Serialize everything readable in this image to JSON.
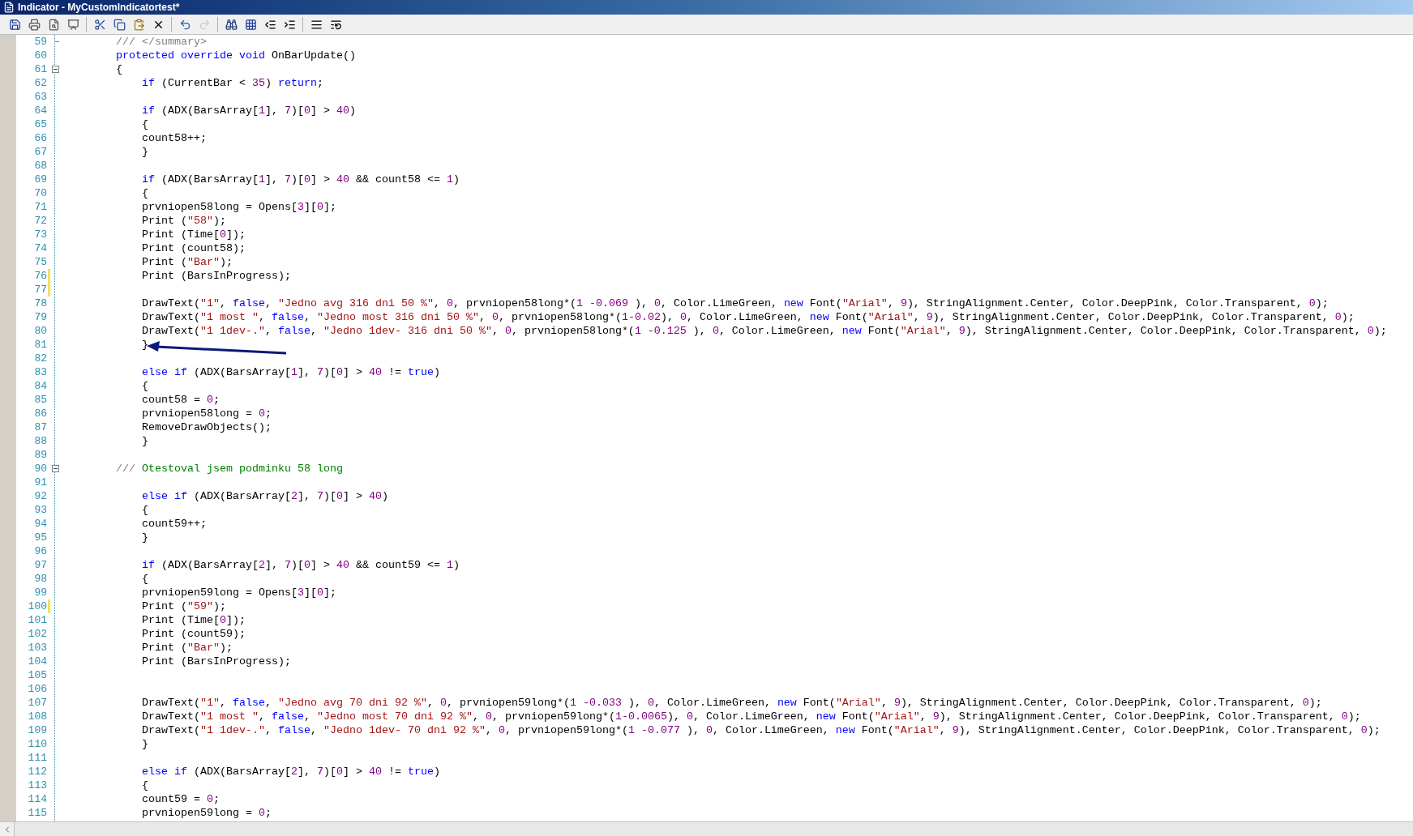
{
  "window": {
    "title": "Indicator - MyCustomIndicatortest*"
  },
  "toolbar": {
    "buttons": [
      {
        "disabled": false
      },
      {
        "disabled": false
      },
      {
        "disabled": false
      },
      {
        "disabled": false
      },
      {
        "disabled": false
      },
      {
        "disabled": false
      },
      {
        "disabled": false
      },
      {
        "disabled": false
      },
      {
        "disabled": false
      },
      {
        "disabled": true
      },
      {
        "disabled": false
      },
      {
        "disabled": false
      },
      {
        "disabled": false
      },
      {
        "disabled": false
      },
      {
        "disabled": false
      },
      {
        "disabled": false
      }
    ]
  },
  "editor": {
    "lines": [
      {
        "number": "59",
        "changed": false,
        "kind": "foldend",
        "tokens": [
          {
            "text": "        /// </summary>",
            "kind": "doc"
          }
        ]
      },
      {
        "number": "60",
        "changed": false,
        "kind": "code",
        "tokens": [
          {
            "text": "        protected override void",
            "kind": "keyword"
          },
          {
            "text": " OnBarUpdate()",
            "kind": "plain"
          }
        ]
      },
      {
        "number": "61",
        "changed": false,
        "kind": "foldstart",
        "tokens": [
          {
            "text": "        {",
            "kind": "plain"
          }
        ]
      },
      {
        "number": "62",
        "changed": false,
        "kind": "code",
        "tokens": [
          {
            "text": "            if",
            "kind": "keyword"
          },
          {
            "text": " (CurrentBar < ",
            "kind": "plain"
          },
          {
            "text": "35",
            "kind": "number"
          },
          {
            "text": ") ",
            "kind": "plain"
          },
          {
            "text": "return",
            "kind": "keyword"
          },
          {
            "text": ";",
            "kind": "plain"
          }
        ]
      },
      {
        "number": "63",
        "changed": false,
        "kind": "code"
      },
      {
        "number": "64",
        "changed": false,
        "kind": "code",
        "tokens": [
          {
            "text": "            if",
            "kind": "keyword"
          },
          {
            "text": " (ADX(BarsArray[",
            "kind": "plain"
          },
          {
            "text": "1",
            "kind": "number"
          },
          {
            "text": "], ",
            "kind": "plain"
          },
          {
            "text": "7",
            "kind": "number"
          },
          {
            "text": ")[",
            "kind": "plain"
          },
          {
            "text": "0",
            "kind": "number"
          },
          {
            "text": "] > ",
            "kind": "plain"
          },
          {
            "text": "40",
            "kind": "number"
          },
          {
            "text": ")",
            "kind": "plain"
          }
        ]
      },
      {
        "number": "65",
        "changed": false,
        "kind": "code",
        "tokens": [
          {
            "text": "            {",
            "kind": "plain"
          }
        ]
      },
      {
        "number": "66",
        "changed": false,
        "kind": "code",
        "tokens": [
          {
            "text": "            count58++;",
            "kind": "plain"
          }
        ]
      },
      {
        "number": "67",
        "changed": false,
        "kind": "code",
        "tokens": [
          {
            "text": "            }",
            "kind": "plain"
          }
        ]
      },
      {
        "number": "68",
        "changed": false,
        "kind": "code"
      },
      {
        "number": "69",
        "changed": false,
        "kind": "code",
        "tokens": [
          {
            "text": "            if",
            "kind": "keyword"
          },
          {
            "text": " (ADX(BarsArray[",
            "kind": "plain"
          },
          {
            "text": "1",
            "kind": "number"
          },
          {
            "text": "], ",
            "kind": "plain"
          },
          {
            "text": "7",
            "kind": "number"
          },
          {
            "text": ")[",
            "kind": "plain"
          },
          {
            "text": "0",
            "kind": "number"
          },
          {
            "text": "] > ",
            "kind": "plain"
          },
          {
            "text": "40",
            "kind": "number"
          },
          {
            "text": " && count58 <= ",
            "kind": "plain"
          },
          {
            "text": "1",
            "kind": "number"
          },
          {
            "text": ")",
            "kind": "plain"
          }
        ]
      },
      {
        "number": "70",
        "changed": false,
        "kind": "code",
        "tokens": [
          {
            "text": "            {",
            "kind": "plain"
          }
        ]
      },
      {
        "number": "71",
        "changed": false,
        "kind": "code",
        "tokens": [
          {
            "text": "            prvniopen58long = Opens[",
            "kind": "plain"
          },
          {
            "text": "3",
            "kind": "number"
          },
          {
            "text": "][",
            "kind": "plain"
          },
          {
            "text": "0",
            "kind": "number"
          },
          {
            "text": "];",
            "kind": "plain"
          }
        ]
      },
      {
        "number": "72",
        "changed": false,
        "kind": "code",
        "tokens": [
          {
            "text": "            Print (",
            "kind": "plain"
          },
          {
            "text": "\"58\"",
            "kind": "string"
          },
          {
            "text": ");",
            "kind": "plain"
          }
        ]
      },
      {
        "number": "73",
        "changed": false,
        "kind": "code",
        "tokens": [
          {
            "text": "            Print (Time[",
            "kind": "plain"
          },
          {
            "text": "0",
            "kind": "number"
          },
          {
            "text": "]);",
            "kind": "plain"
          }
        ]
      },
      {
        "number": "74",
        "changed": false,
        "kind": "code",
        "tokens": [
          {
            "text": "            Print (count58);",
            "kind": "plain"
          }
        ]
      },
      {
        "number": "75",
        "changed": false,
        "kind": "code",
        "tokens": [
          {
            "text": "            Print (",
            "kind": "plain"
          },
          {
            "text": "\"Bar\"",
            "kind": "string"
          },
          {
            "text": ");",
            "kind": "plain"
          }
        ]
      },
      {
        "number": "76",
        "changed": true,
        "kind": "code",
        "tokens": [
          {
            "text": "            Print (BarsInProgress);",
            "kind": "plain"
          }
        ]
      },
      {
        "number": "77",
        "changed": true,
        "kind": "code"
      },
      {
        "number": "78",
        "changed": false,
        "kind": "code",
        "tokens": [
          {
            "text": "            DrawText(",
            "kind": "plain"
          },
          {
            "text": "\"1\"",
            "kind": "string"
          },
          {
            "text": ", ",
            "kind": "plain"
          },
          {
            "text": "false",
            "kind": "keyword"
          },
          {
            "text": ", ",
            "kind": "plain"
          },
          {
            "text": "\"Jedno avg 316 dni 50 %\"",
            "kind": "string"
          },
          {
            "text": ", ",
            "kind": "plain"
          },
          {
            "text": "0",
            "kind": "number"
          },
          {
            "text": ", prvniopen58long*(",
            "kind": "plain"
          },
          {
            "text": "1 -0.069",
            "kind": "number"
          },
          {
            "text": " ), ",
            "kind": "plain"
          },
          {
            "text": "0",
            "kind": "number"
          },
          {
            "text": ", Color.LimeGreen, ",
            "kind": "plain"
          },
          {
            "text": "new",
            "kind": "keyword"
          },
          {
            "text": " Font(",
            "kind": "plain"
          },
          {
            "text": "\"Arial\"",
            "kind": "string"
          },
          {
            "text": ", ",
            "kind": "plain"
          },
          {
            "text": "9",
            "kind": "number"
          },
          {
            "text": "), StringAlignment.Center, Color.DeepPink, Color.Transparent, ",
            "kind": "plain"
          },
          {
            "text": "0",
            "kind": "number"
          },
          {
            "text": ");",
            "kind": "plain"
          }
        ]
      },
      {
        "number": "79",
        "changed": false,
        "kind": "code",
        "tokens": [
          {
            "text": "            DrawText(",
            "kind": "plain"
          },
          {
            "text": "\"1 most \"",
            "kind": "string"
          },
          {
            "text": ", ",
            "kind": "plain"
          },
          {
            "text": "false",
            "kind": "keyword"
          },
          {
            "text": ", ",
            "kind": "plain"
          },
          {
            "text": "\"Jedno most 316 dni 50 %\"",
            "kind": "string"
          },
          {
            "text": ", ",
            "kind": "plain"
          },
          {
            "text": "0",
            "kind": "number"
          },
          {
            "text": ", prvniopen58long*(",
            "kind": "plain"
          },
          {
            "text": "1-0.02",
            "kind": "number"
          },
          {
            "text": "), ",
            "kind": "plain"
          },
          {
            "text": "0",
            "kind": "number"
          },
          {
            "text": ", Color.LimeGreen, ",
            "kind": "plain"
          },
          {
            "text": "new",
            "kind": "keyword"
          },
          {
            "text": " Font(",
            "kind": "plain"
          },
          {
            "text": "\"Arial\"",
            "kind": "string"
          },
          {
            "text": ", ",
            "kind": "plain"
          },
          {
            "text": "9",
            "kind": "number"
          },
          {
            "text": "), StringAlignment.Center, Color.DeepPink, Color.Transparent, ",
            "kind": "plain"
          },
          {
            "text": "0",
            "kind": "number"
          },
          {
            "text": ");",
            "kind": "plain"
          }
        ]
      },
      {
        "number": "80",
        "changed": false,
        "kind": "code",
        "tokens": [
          {
            "text": "            DrawText(",
            "kind": "plain"
          },
          {
            "text": "\"1 1dev-.\"",
            "kind": "string"
          },
          {
            "text": ", ",
            "kind": "plain"
          },
          {
            "text": "false",
            "kind": "keyword"
          },
          {
            "text": ", ",
            "kind": "plain"
          },
          {
            "text": "\"Jedno 1dev- 316 dni 50 %\"",
            "kind": "string"
          },
          {
            "text": ", ",
            "kind": "plain"
          },
          {
            "text": "0",
            "kind": "number"
          },
          {
            "text": ", prvniopen58long*(",
            "kind": "plain"
          },
          {
            "text": "1 -0.125",
            "kind": "number"
          },
          {
            "text": " ), ",
            "kind": "plain"
          },
          {
            "text": "0",
            "kind": "number"
          },
          {
            "text": ", Color.LimeGreen, ",
            "kind": "plain"
          },
          {
            "text": "new",
            "kind": "keyword"
          },
          {
            "text": " Font(",
            "kind": "plain"
          },
          {
            "text": "\"Arial\"",
            "kind": "string"
          },
          {
            "text": ", ",
            "kind": "plain"
          },
          {
            "text": "9",
            "kind": "number"
          },
          {
            "text": "), StringAlignment.Center, Color.DeepPink, Color.Transparent, ",
            "kind": "plain"
          },
          {
            "text": "0",
            "kind": "number"
          },
          {
            "text": ");",
            "kind": "plain"
          }
        ]
      },
      {
        "number": "81",
        "changed": false,
        "kind": "code",
        "tokens": [
          {
            "text": "            }",
            "kind": "plain"
          }
        ]
      },
      {
        "number": "82",
        "changed": false,
        "kind": "code"
      },
      {
        "number": "83",
        "changed": false,
        "kind": "code",
        "tokens": [
          {
            "text": "            else if",
            "kind": "keyword"
          },
          {
            "text": " (ADX(BarsArray[",
            "kind": "plain"
          },
          {
            "text": "1",
            "kind": "number"
          },
          {
            "text": "], ",
            "kind": "plain"
          },
          {
            "text": "7",
            "kind": "number"
          },
          {
            "text": ")[",
            "kind": "plain"
          },
          {
            "text": "0",
            "kind": "number"
          },
          {
            "text": "] > ",
            "kind": "plain"
          },
          {
            "text": "40",
            "kind": "number"
          },
          {
            "text": " != ",
            "kind": "plain"
          },
          {
            "text": "true",
            "kind": "keyword"
          },
          {
            "text": ")",
            "kind": "plain"
          }
        ]
      },
      {
        "number": "84",
        "changed": false,
        "kind": "code",
        "tokens": [
          {
            "text": "            {",
            "kind": "plain"
          }
        ]
      },
      {
        "number": "85",
        "changed": false,
        "kind": "code",
        "tokens": [
          {
            "text": "            count58 = ",
            "kind": "plain"
          },
          {
            "text": "0",
            "kind": "number"
          },
          {
            "text": ";",
            "kind": "plain"
          }
        ]
      },
      {
        "number": "86",
        "changed": false,
        "kind": "code",
        "tokens": [
          {
            "text": "            prvniopen58long = ",
            "kind": "plain"
          },
          {
            "text": "0",
            "kind": "number"
          },
          {
            "text": ";",
            "kind": "plain"
          }
        ]
      },
      {
        "number": "87",
        "changed": false,
        "kind": "code",
        "tokens": [
          {
            "text": "            RemoveDrawObjects();",
            "kind": "plain"
          }
        ]
      },
      {
        "number": "88",
        "changed": false,
        "kind": "code",
        "tokens": [
          {
            "text": "            }",
            "kind": "plain"
          }
        ]
      },
      {
        "number": "89",
        "changed": false,
        "kind": "code"
      },
      {
        "number": "90",
        "changed": false,
        "kind": "foldstart",
        "tokens": [
          {
            "text": "        ///",
            "kind": "doc"
          },
          {
            "text": " Otestoval jsem podminku 58 long",
            "kind": "comment"
          }
        ]
      },
      {
        "number": "91",
        "changed": false,
        "kind": "code"
      },
      {
        "number": "92",
        "changed": false,
        "kind": "code",
        "tokens": [
          {
            "text": "            else if",
            "kind": "keyword"
          },
          {
            "text": " (ADX(BarsArray[",
            "kind": "plain"
          },
          {
            "text": "2",
            "kind": "number"
          },
          {
            "text": "], ",
            "kind": "plain"
          },
          {
            "text": "7",
            "kind": "number"
          },
          {
            "text": ")[",
            "kind": "plain"
          },
          {
            "text": "0",
            "kind": "number"
          },
          {
            "text": "] > ",
            "kind": "plain"
          },
          {
            "text": "40",
            "kind": "number"
          },
          {
            "text": ")",
            "kind": "plain"
          }
        ]
      },
      {
        "number": "93",
        "changed": false,
        "kind": "code",
        "tokens": [
          {
            "text": "            {",
            "kind": "plain"
          }
        ]
      },
      {
        "number": "94",
        "changed": false,
        "kind": "code",
        "tokens": [
          {
            "text": "            count59++;",
            "kind": "plain"
          }
        ]
      },
      {
        "number": "95",
        "changed": false,
        "kind": "code",
        "tokens": [
          {
            "text": "            }",
            "kind": "plain"
          }
        ]
      },
      {
        "number": "96",
        "changed": false,
        "kind": "code"
      },
      {
        "number": "97",
        "changed": false,
        "kind": "code",
        "tokens": [
          {
            "text": "            if",
            "kind": "keyword"
          },
          {
            "text": " (ADX(BarsArray[",
            "kind": "plain"
          },
          {
            "text": "2",
            "kind": "number"
          },
          {
            "text": "], ",
            "kind": "plain"
          },
          {
            "text": "7",
            "kind": "number"
          },
          {
            "text": ")[",
            "kind": "plain"
          },
          {
            "text": "0",
            "kind": "number"
          },
          {
            "text": "] > ",
            "kind": "plain"
          },
          {
            "text": "40",
            "kind": "number"
          },
          {
            "text": " && count59 <= ",
            "kind": "plain"
          },
          {
            "text": "1",
            "kind": "number"
          },
          {
            "text": ")",
            "kind": "plain"
          }
        ]
      },
      {
        "number": "98",
        "changed": false,
        "kind": "code",
        "tokens": [
          {
            "text": "            {",
            "kind": "plain"
          }
        ]
      },
      {
        "number": "99",
        "changed": false,
        "kind": "code",
        "tokens": [
          {
            "text": "            prvniopen59long = Opens[",
            "kind": "plain"
          },
          {
            "text": "3",
            "kind": "number"
          },
          {
            "text": "][",
            "kind": "plain"
          },
          {
            "text": "0",
            "kind": "number"
          },
          {
            "text": "];",
            "kind": "plain"
          }
        ]
      },
      {
        "number": "100",
        "changed": true,
        "kind": "code",
        "tokens": [
          {
            "text": "            Print (",
            "kind": "plain"
          },
          {
            "text": "\"59\"",
            "kind": "string"
          },
          {
            "text": ");",
            "kind": "plain"
          }
        ]
      },
      {
        "number": "101",
        "changed": false,
        "kind": "code",
        "tokens": [
          {
            "text": "            Print (Time[",
            "kind": "plain"
          },
          {
            "text": "0",
            "kind": "number"
          },
          {
            "text": "]);",
            "kind": "plain"
          }
        ]
      },
      {
        "number": "102",
        "changed": false,
        "kind": "code",
        "tokens": [
          {
            "text": "            Print (count59);",
            "kind": "plain"
          }
        ]
      },
      {
        "number": "103",
        "changed": false,
        "kind": "code",
        "tokens": [
          {
            "text": "            Print (",
            "kind": "plain"
          },
          {
            "text": "\"Bar\"",
            "kind": "string"
          },
          {
            "text": ");",
            "kind": "plain"
          }
        ]
      },
      {
        "number": "104",
        "changed": false,
        "kind": "code",
        "tokens": [
          {
            "text": "            Print (BarsInProgress);",
            "kind": "plain"
          }
        ]
      },
      {
        "number": "105",
        "changed": false,
        "kind": "code"
      },
      {
        "number": "106",
        "changed": false,
        "kind": "code"
      },
      {
        "number": "107",
        "changed": false,
        "kind": "code",
        "tokens": [
          {
            "text": "            DrawText(",
            "kind": "plain"
          },
          {
            "text": "\"1\"",
            "kind": "string"
          },
          {
            "text": ", ",
            "kind": "plain"
          },
          {
            "text": "false",
            "kind": "keyword"
          },
          {
            "text": ", ",
            "kind": "plain"
          },
          {
            "text": "\"Jedno avg 70 dni 92 %\"",
            "kind": "string"
          },
          {
            "text": ", ",
            "kind": "plain"
          },
          {
            "text": "0",
            "kind": "number"
          },
          {
            "text": ", prvniopen59long*(",
            "kind": "plain"
          },
          {
            "text": "1 -0.033",
            "kind": "number"
          },
          {
            "text": " ), ",
            "kind": "plain"
          },
          {
            "text": "0",
            "kind": "number"
          },
          {
            "text": ", Color.LimeGreen, ",
            "kind": "plain"
          },
          {
            "text": "new",
            "kind": "keyword"
          },
          {
            "text": " Font(",
            "kind": "plain"
          },
          {
            "text": "\"Arial\"",
            "kind": "string"
          },
          {
            "text": ", ",
            "kind": "plain"
          },
          {
            "text": "9",
            "kind": "number"
          },
          {
            "text": "), StringAlignment.Center, Color.DeepPink, Color.Transparent, ",
            "kind": "plain"
          },
          {
            "text": "0",
            "kind": "number"
          },
          {
            "text": ");",
            "kind": "plain"
          }
        ]
      },
      {
        "number": "108",
        "changed": false,
        "kind": "code",
        "tokens": [
          {
            "text": "            DrawText(",
            "kind": "plain"
          },
          {
            "text": "\"1 most \"",
            "kind": "string"
          },
          {
            "text": ", ",
            "kind": "plain"
          },
          {
            "text": "false",
            "kind": "keyword"
          },
          {
            "text": ", ",
            "kind": "plain"
          },
          {
            "text": "\"Jedno most 70 dni 92 %\"",
            "kind": "string"
          },
          {
            "text": ", ",
            "kind": "plain"
          },
          {
            "text": "0",
            "kind": "number"
          },
          {
            "text": ", prvniopen59long*(",
            "kind": "plain"
          },
          {
            "text": "1-0.0065",
            "kind": "number"
          },
          {
            "text": "), ",
            "kind": "plain"
          },
          {
            "text": "0",
            "kind": "number"
          },
          {
            "text": ", Color.LimeGreen, ",
            "kind": "plain"
          },
          {
            "text": "new",
            "kind": "keyword"
          },
          {
            "text": " Font(",
            "kind": "plain"
          },
          {
            "text": "\"Arial\"",
            "kind": "string"
          },
          {
            "text": ", ",
            "kind": "plain"
          },
          {
            "text": "9",
            "kind": "number"
          },
          {
            "text": "), StringAlignment.Center, Color.DeepPink, Color.Transparent, ",
            "kind": "plain"
          },
          {
            "text": "0",
            "kind": "number"
          },
          {
            "text": ");",
            "kind": "plain"
          }
        ]
      },
      {
        "number": "109",
        "changed": false,
        "kind": "code",
        "tokens": [
          {
            "text": "            DrawText(",
            "kind": "plain"
          },
          {
            "text": "\"1 1dev-.\"",
            "kind": "string"
          },
          {
            "text": ", ",
            "kind": "plain"
          },
          {
            "text": "false",
            "kind": "keyword"
          },
          {
            "text": ", ",
            "kind": "plain"
          },
          {
            "text": "\"Jedno 1dev- 70 dni 92 %\"",
            "kind": "string"
          },
          {
            "text": ", ",
            "kind": "plain"
          },
          {
            "text": "0",
            "kind": "number"
          },
          {
            "text": ", prvniopen59long*(",
            "kind": "plain"
          },
          {
            "text": "1 -0.077",
            "kind": "number"
          },
          {
            "text": " ), ",
            "kind": "plain"
          },
          {
            "text": "0",
            "kind": "number"
          },
          {
            "text": ", Color.LimeGreen, ",
            "kind": "plain"
          },
          {
            "text": "new",
            "kind": "keyword"
          },
          {
            "text": " Font(",
            "kind": "plain"
          },
          {
            "text": "\"Arial\"",
            "kind": "string"
          },
          {
            "text": ", ",
            "kind": "plain"
          },
          {
            "text": "9",
            "kind": "number"
          },
          {
            "text": "), StringAlignment.Center, Color.DeepPink, Color.Transparent, ",
            "kind": "plain"
          },
          {
            "text": "0",
            "kind": "number"
          },
          {
            "text": ");",
            "kind": "plain"
          }
        ]
      },
      {
        "number": "110",
        "changed": false,
        "kind": "code",
        "tokens": [
          {
            "text": "            }",
            "kind": "plain"
          }
        ]
      },
      {
        "number": "111",
        "changed": false,
        "kind": "code"
      },
      {
        "number": "112",
        "changed": false,
        "kind": "code",
        "tokens": [
          {
            "text": "            else if",
            "kind": "keyword"
          },
          {
            "text": " (ADX(BarsArray[",
            "kind": "plain"
          },
          {
            "text": "2",
            "kind": "number"
          },
          {
            "text": "], ",
            "kind": "plain"
          },
          {
            "text": "7",
            "kind": "number"
          },
          {
            "text": ")[",
            "kind": "plain"
          },
          {
            "text": "0",
            "kind": "number"
          },
          {
            "text": "] > ",
            "kind": "plain"
          },
          {
            "text": "40",
            "kind": "number"
          },
          {
            "text": " != ",
            "kind": "plain"
          },
          {
            "text": "true",
            "kind": "keyword"
          },
          {
            "text": ")",
            "kind": "plain"
          }
        ]
      },
      {
        "number": "113",
        "changed": false,
        "kind": "code",
        "tokens": [
          {
            "text": "            {",
            "kind": "plain"
          }
        ]
      },
      {
        "number": "114",
        "changed": false,
        "kind": "code",
        "tokens": [
          {
            "text": "            count59 = ",
            "kind": "plain"
          },
          {
            "text": "0",
            "kind": "number"
          },
          {
            "text": ";",
            "kind": "plain"
          }
        ]
      },
      {
        "number": "115",
        "changed": false,
        "kind": "code",
        "tokens": [
          {
            "text": "            prvniopen59long = ",
            "kind": "plain"
          },
          {
            "text": "0",
            "kind": "number"
          },
          {
            "text": ";",
            "kind": "plain"
          }
        ]
      }
    ]
  }
}
